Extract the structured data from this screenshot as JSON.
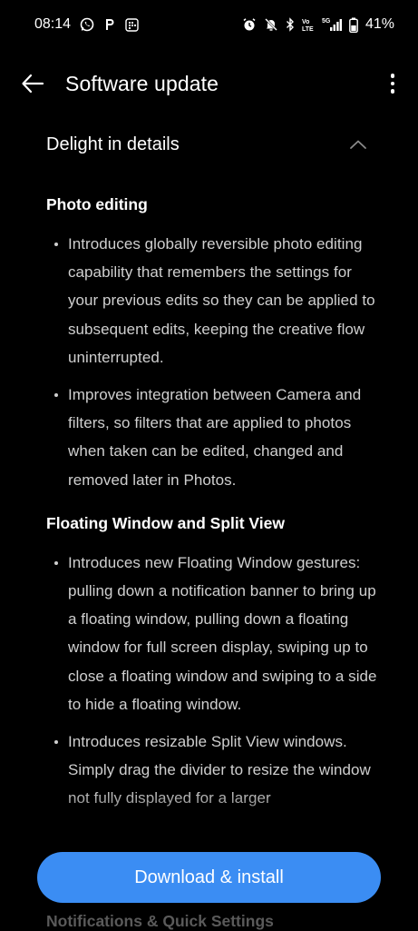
{
  "status_bar": {
    "time": "08:14",
    "battery": "41%",
    "network": "5G",
    "volte": "Vo LTE",
    "left_icons": [
      "whatsapp-icon",
      "p-app-icon",
      "calendar-grid-icon"
    ],
    "right_icons": [
      "alarm-icon",
      "mute-icon",
      "bluetooth-icon",
      "volte-icon",
      "signal-icon",
      "battery-icon"
    ]
  },
  "app_bar": {
    "title": "Software update",
    "back_icon": "back-arrow-icon",
    "menu_icon": "more-vert-icon"
  },
  "section": {
    "title": "Delight in details",
    "expanded": true,
    "groups": [
      {
        "heading": "Photo editing",
        "bullets": [
          "Introduces globally reversible photo editing capability that remembers the settings for your previous edits so they can be applied to subsequent edits, keeping the creative flow uninterrupted.",
          "Improves integration between Camera and filters, so filters that are applied to photos when taken can be edited, changed and removed later in Photos."
        ]
      },
      {
        "heading": "Floating Window and Split View",
        "bullets": [
          "Introduces new Floating Window gestures: pulling down a notification banner to bring up a floating window, pulling down a floating window for full screen display, swiping up to close a floating window and swiping to a side to hide a floating window.",
          "Introduces resizable Split View windows. Simply drag the divider to resize the window not fully displayed for a larger"
        ]
      }
    ],
    "next_heading": "Notifications & Quick Settings"
  },
  "actions": {
    "download_label": "Download & install"
  },
  "colors": {
    "background": "#000000",
    "accent": "#3b8df3",
    "body_text": "#cfcfcf"
  }
}
